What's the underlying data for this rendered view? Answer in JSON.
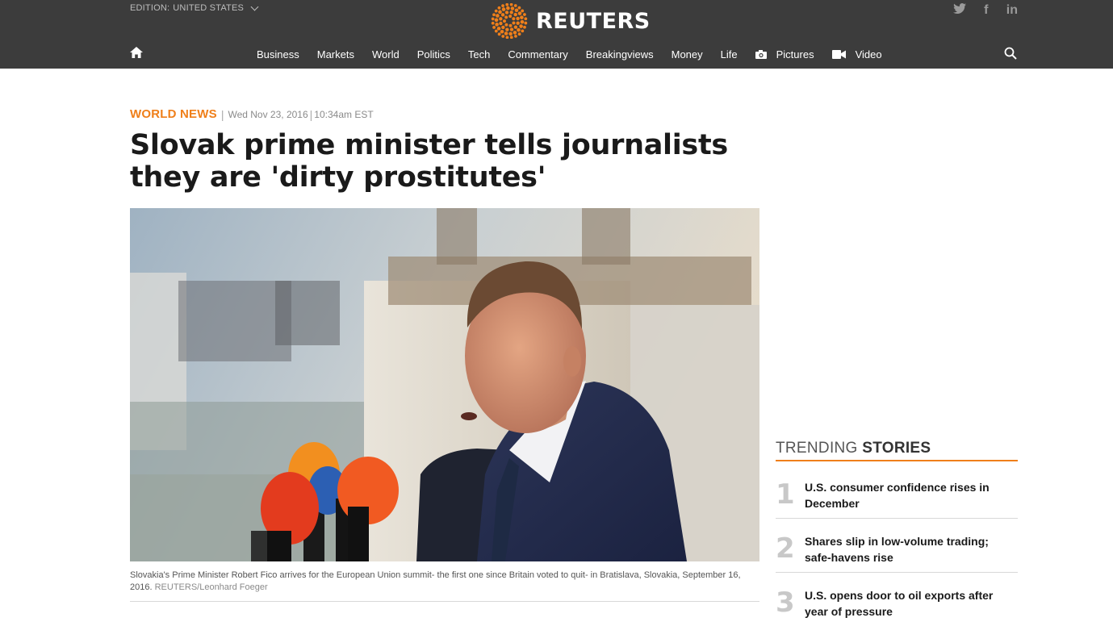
{
  "header": {
    "edition_label": "EDITION:",
    "edition_value": "UNITED STATES",
    "logo_text": "REUTERS",
    "social": {
      "twitter": "twitter-icon",
      "facebook": "f",
      "linkedin": "in"
    }
  },
  "nav": {
    "items": [
      {
        "label": "Business"
      },
      {
        "label": "Markets"
      },
      {
        "label": "World"
      },
      {
        "label": "Politics"
      },
      {
        "label": "Tech"
      },
      {
        "label": "Commentary"
      },
      {
        "label": "Breakingviews"
      },
      {
        "label": "Money"
      },
      {
        "label": "Life"
      },
      {
        "label": "Pictures",
        "icon": "camera-icon"
      },
      {
        "label": "Video",
        "icon": "video-camera-icon"
      }
    ]
  },
  "article": {
    "section": "WORLD NEWS",
    "date": "Wed Nov 23, 2016",
    "time": "10:34am EST",
    "headline": "Slovak prime minister tells journalists they are 'dirty prostitutes'",
    "caption": "Slovakia's Prime Minister Robert Fico arrives for the European Union summit- the first one since Britain voted to quit- in Bratislava, Slovakia, September 16, 2016.",
    "credit": "REUTERS/Leonhard Foeger"
  },
  "trending": {
    "title_light": "TRENDING",
    "title_bold": "STORIES",
    "items": [
      {
        "num": "1",
        "text": "U.S. consumer confidence rises in December"
      },
      {
        "num": "2",
        "text": "Shares slip in low-volume trading; safe-havens rise"
      },
      {
        "num": "3",
        "text": "U.S. opens door to oil exports after year of pressure"
      }
    ]
  },
  "colors": {
    "accent": "#ef7f1a",
    "header_bg": "#3c3c3c"
  }
}
